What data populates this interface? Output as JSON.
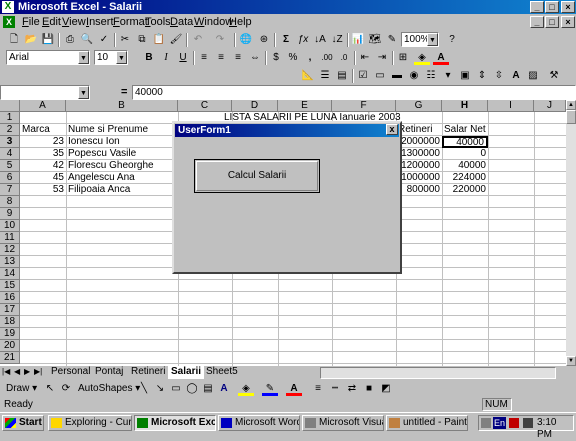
{
  "window": {
    "title": "Microsoft Excel - Salarii",
    "app_logo": "X"
  },
  "menubar": {
    "items": [
      "File",
      "Edit",
      "View",
      "Insert",
      "Format",
      "Tools",
      "Data",
      "Window",
      "Help"
    ]
  },
  "standard_toolbar": {
    "zoom": "100%"
  },
  "format_toolbar": {
    "font": "Arial",
    "size": "10",
    "bold": "B",
    "italic": "I",
    "underline": "U",
    "percent": "%",
    "comma": ",",
    "currency": "$"
  },
  "formula_bar": {
    "name_box": "",
    "equals": "=",
    "value": "40000"
  },
  "grid": {
    "columns": [
      "A",
      "B",
      "C",
      "D",
      "E",
      "F",
      "G",
      "H",
      "I",
      "J"
    ],
    "rows": [
      "1",
      "2",
      "3",
      "4",
      "5",
      "6",
      "7",
      "8",
      "9",
      "10",
      "11",
      "12",
      "13",
      "14",
      "15",
      "16",
      "17",
      "18",
      "19",
      "20",
      "21"
    ],
    "title": "LISTA SALARII PE LUNA Ianuarie 2003",
    "headers": {
      "marca": "Marca",
      "nume": "Nume si Prenume",
      "retineri": "Retineri",
      "salar_net": "Salar Net"
    },
    "records": [
      {
        "marca": "23",
        "nume": "Ionescu Ion",
        "retineri": "2000000",
        "salar_net": "40000"
      },
      {
        "marca": "35",
        "nume": "Popescu Vasile",
        "retineri": "1300000",
        "salar_net": "0"
      },
      {
        "marca": "42",
        "nume": "Florescu Gheorghe",
        "retineri": "1200000",
        "salar_net": "40000"
      },
      {
        "marca": "45",
        "nume": "Angelescu Ana",
        "retineri": "1000000",
        "salar_net": "224000"
      },
      {
        "marca": "53",
        "nume": "Filipoaia Anca",
        "retineri": "800000",
        "salar_net": "220000"
      }
    ],
    "active_cell": "H3"
  },
  "sheet_tabs": {
    "tabs": [
      "Personal",
      "Pontaj",
      "Retineri",
      "Salarii",
      "Sheet5"
    ],
    "active": "Salarii"
  },
  "dialog": {
    "title": "UserForm1",
    "close": "x",
    "button_label": "Calcul Salarii"
  },
  "draw_toolbar": {
    "draw_label": "Draw",
    "autoshapes_label": "AutoShapes"
  },
  "status_bar": {
    "left": "Ready",
    "num": "NUM"
  },
  "taskbar": {
    "start": "Start",
    "tasks": [
      "Exploring - CursL...",
      "Microsoft Exc...",
      "Microsoft Word - ...",
      "Microsoft Visual ...",
      "untitled - Paint"
    ],
    "lang": "En",
    "clock": "3:10 PM"
  }
}
